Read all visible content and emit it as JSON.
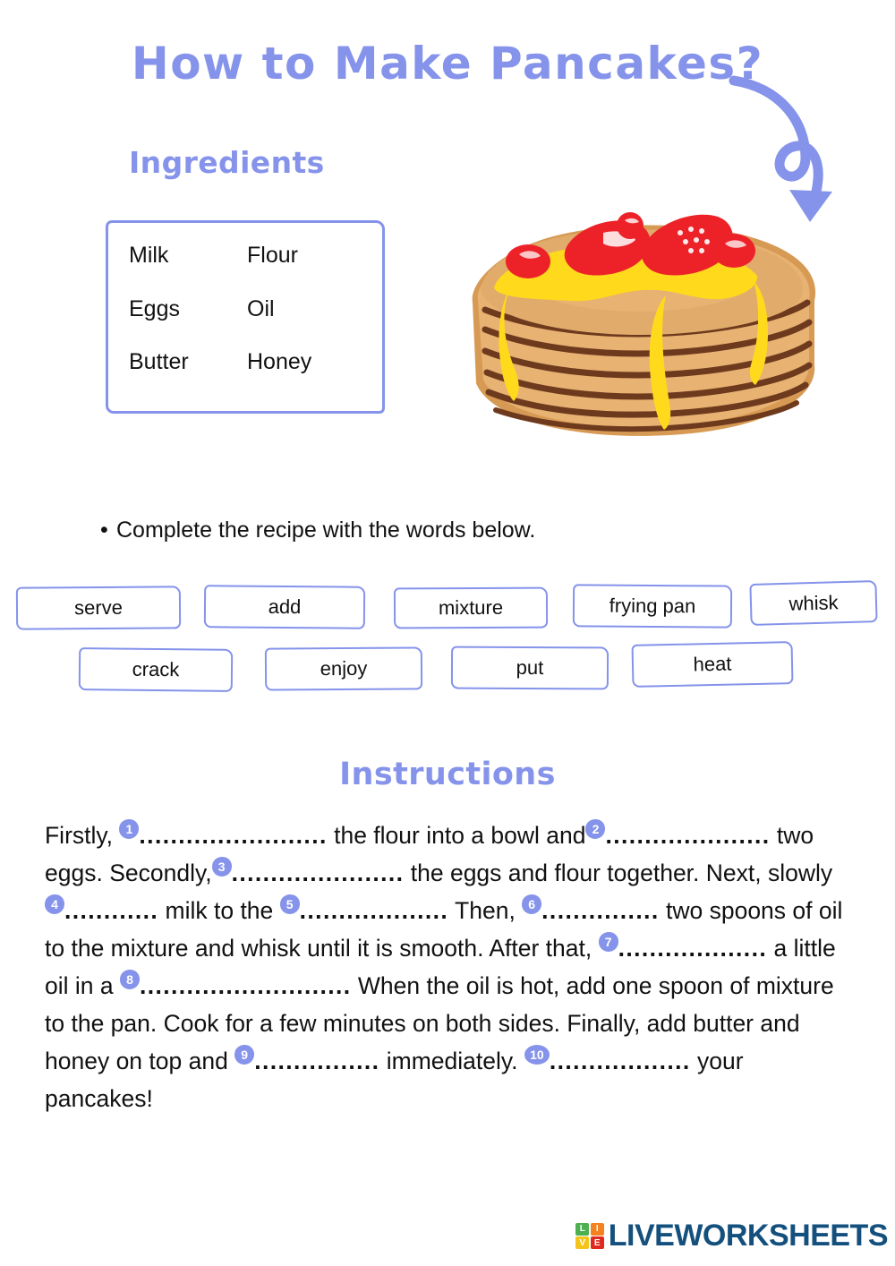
{
  "page": {
    "title": "How to Make Pancakes?",
    "accent_color": "#8593ea",
    "text_color": "#111111",
    "background": "#ffffff"
  },
  "ingredients": {
    "heading": "Ingredients",
    "items": [
      "Milk",
      "Flour",
      "Eggs",
      "Oil",
      "Butter",
      "Honey"
    ]
  },
  "illustration": {
    "name": "pancake-stack-with-strawberries-and-honey",
    "pancake_color": "#e8b272",
    "outline_color": "#6e3a1e",
    "honey_color": "#ffd91c",
    "berry_color": "#ed2229",
    "layers": 7
  },
  "arrow": {
    "name": "curly-arrow-pointing-down",
    "color": "#8593ea"
  },
  "task": {
    "bullet": "•",
    "text": "Complete the recipe with the words below."
  },
  "word_bank": {
    "row1": [
      "serve",
      "add",
      "mixture",
      "frying pan",
      "whisk"
    ],
    "row2": [
      "crack",
      "enjoy",
      "put",
      "heat"
    ]
  },
  "instructions": {
    "heading": "Instructions",
    "segments": [
      {
        "type": "text",
        "value": "Firstly, "
      },
      {
        "type": "blank",
        "value": "1"
      },
      {
        "type": "dots",
        "value": "........................"
      },
      {
        "type": "text",
        "value": " the flour into a bowl and"
      },
      {
        "type": "blank",
        "value": "2"
      },
      {
        "type": "dots",
        "value": "....................."
      },
      {
        "type": "text",
        "value": " two eggs. Secondly,"
      },
      {
        "type": "blank",
        "value": "3"
      },
      {
        "type": "dots",
        "value": "......................"
      },
      {
        "type": "text",
        "value": " the eggs and flour together. Next, slowly"
      },
      {
        "type": "blank",
        "value": "4"
      },
      {
        "type": "dots",
        "value": "............"
      },
      {
        "type": "text",
        "value": " milk  to the "
      },
      {
        "type": "blank",
        "value": "5"
      },
      {
        "type": "dots",
        "value": "..................."
      },
      {
        "type": "text",
        "value": " Then, "
      },
      {
        "type": "blank",
        "value": "6"
      },
      {
        "type": "dots",
        "value": "..............."
      },
      {
        "type": "text",
        "value": " two spoons of oil to the mixture and whisk until it is smooth. After that, "
      },
      {
        "type": "blank",
        "value": "7"
      },
      {
        "type": "dots",
        "value": "..................."
      },
      {
        "type": "text",
        "value": " a little oil in a "
      },
      {
        "type": "blank",
        "value": "8"
      },
      {
        "type": "dots",
        "value": "..........................."
      },
      {
        "type": "text",
        "value": " When the oil is hot, add one spoon of mixture to the pan. Cook for a few minutes on both sides. Finally, add butter and honey on top and "
      },
      {
        "type": "blank",
        "value": "9"
      },
      {
        "type": "dots",
        "value": "................"
      },
      {
        "type": "text",
        "value": " immediately. "
      },
      {
        "type": "blank",
        "value": "10"
      },
      {
        "type": "dots",
        "value": ".................."
      },
      {
        "type": "text",
        "value": " your pancakes!"
      }
    ]
  },
  "footer": {
    "logo_tiles": [
      {
        "letter": "L",
        "color": "#4caf50"
      },
      {
        "letter": "I",
        "color": "#f58220"
      },
      {
        "letter": "V",
        "color": "#f4c41a"
      },
      {
        "letter": "E",
        "color": "#e02a20"
      }
    ],
    "wordmark": "LIVEWORKSHEETS",
    "wordmark_color": "#14507d"
  }
}
